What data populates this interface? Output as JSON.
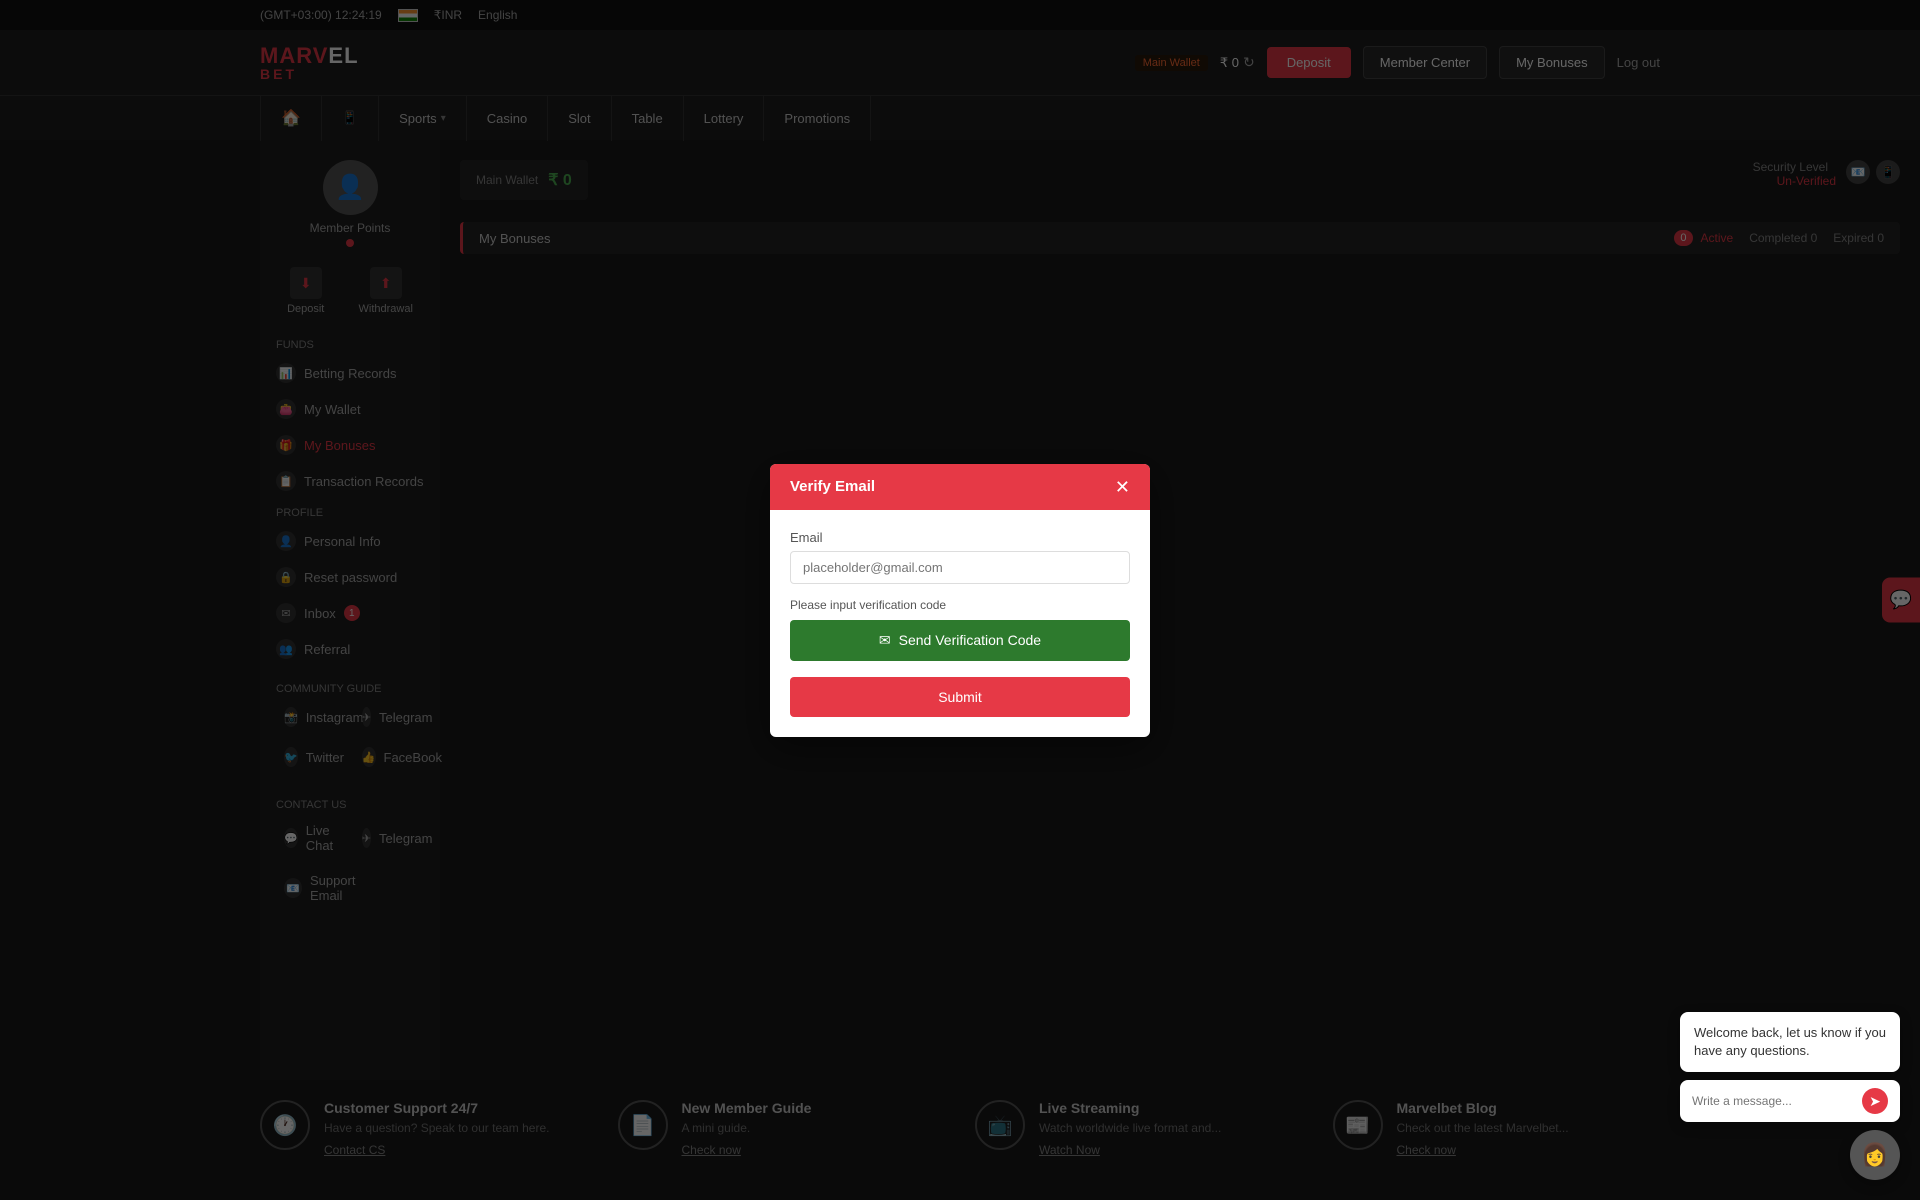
{
  "topbar": {
    "timezone": "(GMT+03:00) 12:24:19",
    "currency": "₹INR",
    "language": "English"
  },
  "header": {
    "logo_marvel": "MARV",
    "logo_marvel2": "EL",
    "logo_bet": "BET",
    "wallet_label": "Main Wallet",
    "balance": "₹ 0",
    "btn_deposit": "Deposit",
    "btn_member": "Member Center",
    "btn_bonuses": "My Bonuses",
    "btn_logout": "Log out"
  },
  "nav": {
    "items": [
      {
        "label": "🏠",
        "id": "home",
        "has_chevron": false
      },
      {
        "label": "📱",
        "id": "mobile",
        "has_chevron": false
      },
      {
        "label": "Sports",
        "id": "sports",
        "has_chevron": true
      },
      {
        "label": "Casino",
        "id": "casino",
        "has_chevron": false
      },
      {
        "label": "Slot",
        "id": "slot",
        "has_chevron": false
      },
      {
        "label": "Table",
        "id": "table",
        "has_chevron": false
      },
      {
        "label": "Lottery",
        "id": "lottery",
        "has_chevron": false
      },
      {
        "label": "Promotions",
        "id": "promotions",
        "has_chevron": false
      }
    ]
  },
  "sidebar": {
    "member_name": "Member Points",
    "deposit_label": "Deposit",
    "withdrawal_label": "Withdrawal",
    "funds_title": "Funds",
    "funds_items": [
      {
        "label": "Betting Records",
        "id": "betting-records"
      },
      {
        "label": "My Wallet",
        "id": "my-wallet"
      },
      {
        "label": "My Bonuses",
        "id": "my-bonuses",
        "active": true
      },
      {
        "label": "Transaction Records",
        "id": "transaction-records"
      }
    ],
    "profile_title": "Profile",
    "profile_items": [
      {
        "label": "Personal Info",
        "id": "personal-info"
      },
      {
        "label": "Reset password",
        "id": "reset-password"
      },
      {
        "label": "Inbox",
        "id": "inbox",
        "badge": "1"
      },
      {
        "label": "Referral",
        "id": "referral"
      }
    ],
    "community_title": "Community Guide",
    "community_items": [
      {
        "label": "Instagram",
        "id": "instagram"
      },
      {
        "label": "Telegram",
        "id": "telegram"
      },
      {
        "label": "Twitter",
        "id": "twitter"
      },
      {
        "label": "FaceBook",
        "id": "facebook"
      }
    ],
    "contact_title": "Contact Us",
    "contact_items": [
      {
        "label": "Live Chat",
        "id": "live-chat"
      },
      {
        "label": "Telegram",
        "id": "telegram-contact"
      },
      {
        "label": "Support Email",
        "id": "support-email"
      }
    ]
  },
  "security": {
    "label": "Security Level",
    "status": "Un-Verified"
  },
  "bonuses": {
    "title": "My Bonuses",
    "tab_active": "Active",
    "tab_active_count": "0",
    "tab_completed": "Completed",
    "tab_completed_count": "0",
    "tab_expired": "Expired",
    "tab_expired_count": "0"
  },
  "wallet": {
    "main_label": "Main Wallet",
    "amount": "0"
  },
  "modal": {
    "title": "Verify Email",
    "email_label": "Email",
    "email_placeholder": "placeholder@gmail.com",
    "verify_label": "Please input verification code",
    "send_btn": "Send Verification Code",
    "submit_btn": "Submit",
    "close_icon": "✕"
  },
  "footer": {
    "cards": [
      {
        "id": "support",
        "icon": "🕐",
        "title": "Customer Support 24/7",
        "desc": "Have a question? Speak to our team here.",
        "link": "Contact CS"
      },
      {
        "id": "guide",
        "icon": "📄",
        "title": "New Member Guide",
        "desc": "A mini guide.",
        "link": "Check now"
      },
      {
        "id": "streaming",
        "icon": "📺",
        "title": "Live Streaming",
        "desc": "Watch worldwide live format and...",
        "link": "Watch Now"
      },
      {
        "id": "blog",
        "icon": "📰",
        "title": "Marvelbet Blog",
        "desc": "Check out the latest Marvelbet...",
        "link": "Check now"
      }
    ]
  },
  "chat": {
    "bubble_text": "Welcome back, let us know if you have any questions.",
    "input_placeholder": "Write a message..."
  }
}
